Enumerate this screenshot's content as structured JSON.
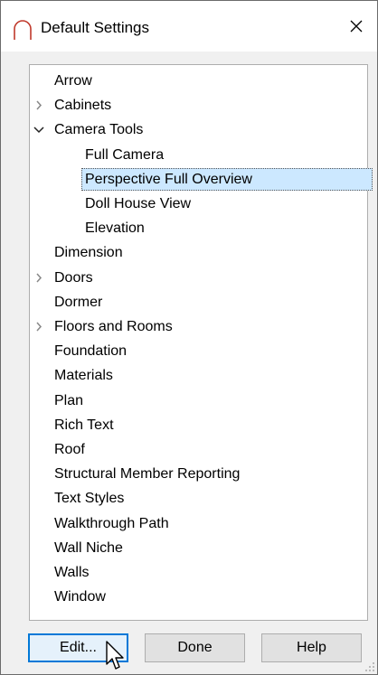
{
  "window": {
    "title": "Default Settings"
  },
  "tree": {
    "items": [
      {
        "label": "Arrow",
        "level": 0,
        "expander": "none"
      },
      {
        "label": "Cabinets",
        "level": 0,
        "expander": "collapsed"
      },
      {
        "label": "Camera Tools",
        "level": 0,
        "expander": "expanded"
      },
      {
        "label": "Full Camera",
        "level": 1,
        "expander": "none"
      },
      {
        "label": "Perspective Full Overview",
        "level": 1,
        "expander": "none",
        "selected": true
      },
      {
        "label": "Doll House View",
        "level": 1,
        "expander": "none"
      },
      {
        "label": "Elevation",
        "level": 1,
        "expander": "none"
      },
      {
        "label": "Dimension",
        "level": 0,
        "expander": "none"
      },
      {
        "label": "Doors",
        "level": 0,
        "expander": "collapsed"
      },
      {
        "label": "Dormer",
        "level": 0,
        "expander": "none"
      },
      {
        "label": "Floors and Rooms",
        "level": 0,
        "expander": "collapsed"
      },
      {
        "label": "Foundation",
        "level": 0,
        "expander": "none"
      },
      {
        "label": "Materials",
        "level": 0,
        "expander": "none"
      },
      {
        "label": "Plan",
        "level": 0,
        "expander": "none"
      },
      {
        "label": "Rich Text",
        "level": 0,
        "expander": "none"
      },
      {
        "label": "Roof",
        "level": 0,
        "expander": "none"
      },
      {
        "label": "Structural Member Reporting",
        "level": 0,
        "expander": "none"
      },
      {
        "label": "Text Styles",
        "level": 0,
        "expander": "none"
      },
      {
        "label": "Walkthrough Path",
        "level": 0,
        "expander": "none"
      },
      {
        "label": "Wall Niche",
        "level": 0,
        "expander": "none"
      },
      {
        "label": "Walls",
        "level": 0,
        "expander": "none"
      },
      {
        "label": "Window",
        "level": 0,
        "expander": "none"
      }
    ]
  },
  "buttons": {
    "edit": "Edit...",
    "done": "Done",
    "help": "Help"
  },
  "icons": {
    "app": "arch-icon",
    "close": "close-icon",
    "expand": "chevron-right-icon",
    "collapse": "chevron-down-icon"
  },
  "colors": {
    "selection": "#cce8ff",
    "default_button_border": "#0078d7",
    "app_icon": "#c0392b"
  }
}
